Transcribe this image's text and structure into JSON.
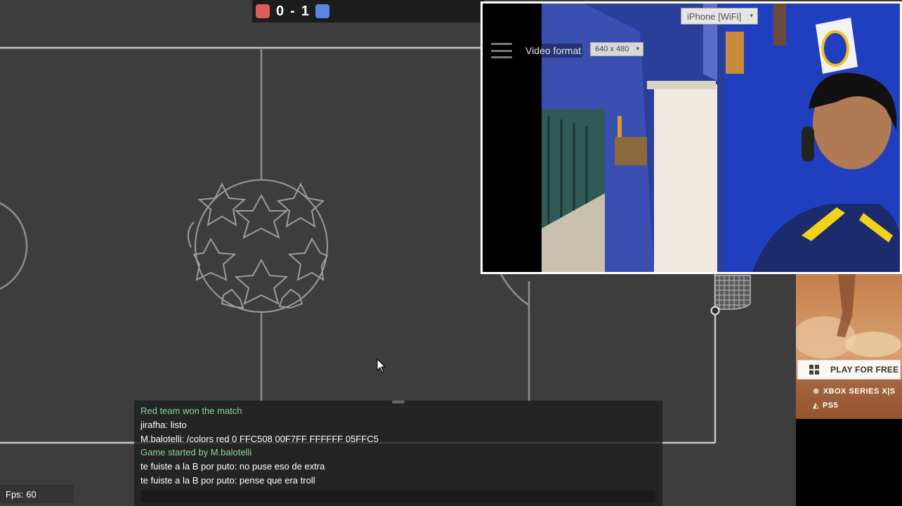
{
  "scoreboard": {
    "red_color": "#e05a5a",
    "blue_color": "#5a86e0",
    "red_score": "0",
    "separator": "-",
    "blue_score": "1"
  },
  "field": {
    "background_color": "#3d3d3d",
    "line_color": "#c8c8c8",
    "ball_outline_color": "#9c9c9c"
  },
  "webcam": {
    "device_select": "iPhone [WiFi]",
    "format_label": "Video format",
    "format_select": "640 x 480"
  },
  "ad": {
    "cta_label": "PLAY FOR FREE",
    "platform_1": "XBOX SERIES X|S",
    "platform_2": "PS5",
    "cta_icon": "windows-icon",
    "xbox_icon": "xbox-icon",
    "ps_icon": "playstation-icon"
  },
  "chat": {
    "messages": [
      {
        "text": "Red team won the match",
        "kind": "system"
      },
      {
        "text": "jirafha: listo",
        "kind": "user"
      },
      {
        "text": "M.balotelli: /colors red 0 FFC508 00F7FF FFFFFF 05FFC5",
        "kind": "user"
      },
      {
        "text": "Game started by M.balotelli",
        "kind": "system"
      },
      {
        "text": "te fuiste a la B por puto: no puse eso de extra",
        "kind": "user"
      },
      {
        "text": "te fuiste a la B por puto: pense que era troll",
        "kind": "user"
      }
    ],
    "input_value": "",
    "input_placeholder": ""
  },
  "fps": {
    "label": "Fps",
    "value": "60"
  }
}
